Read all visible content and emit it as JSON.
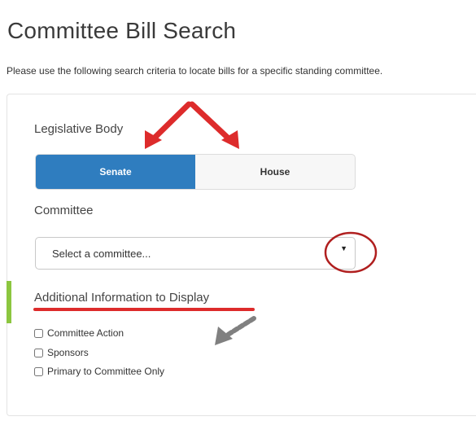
{
  "page": {
    "title": "Committee Bill Search",
    "intro": "Please use the following search criteria to locate bills for a specific standing committee."
  },
  "legislative_body": {
    "label": "Legislative Body",
    "options": [
      "Senate",
      "House"
    ],
    "selected": "Senate"
  },
  "committee": {
    "label": "Committee",
    "placeholder": "Select a committee...",
    "caret": "▼"
  },
  "additional_info": {
    "heading": "Additional Information to Display",
    "options": [
      {
        "label": "Committee Action",
        "checked": false
      },
      {
        "label": "Sponsors",
        "checked": false
      },
      {
        "label": "Primary to Committee Only",
        "checked": false
      }
    ]
  },
  "colors": {
    "accent": "#2f7dbf",
    "annotation_red": "#dd2b2b",
    "annotation_gray": "#808080",
    "marker_green": "#8cc63f"
  }
}
